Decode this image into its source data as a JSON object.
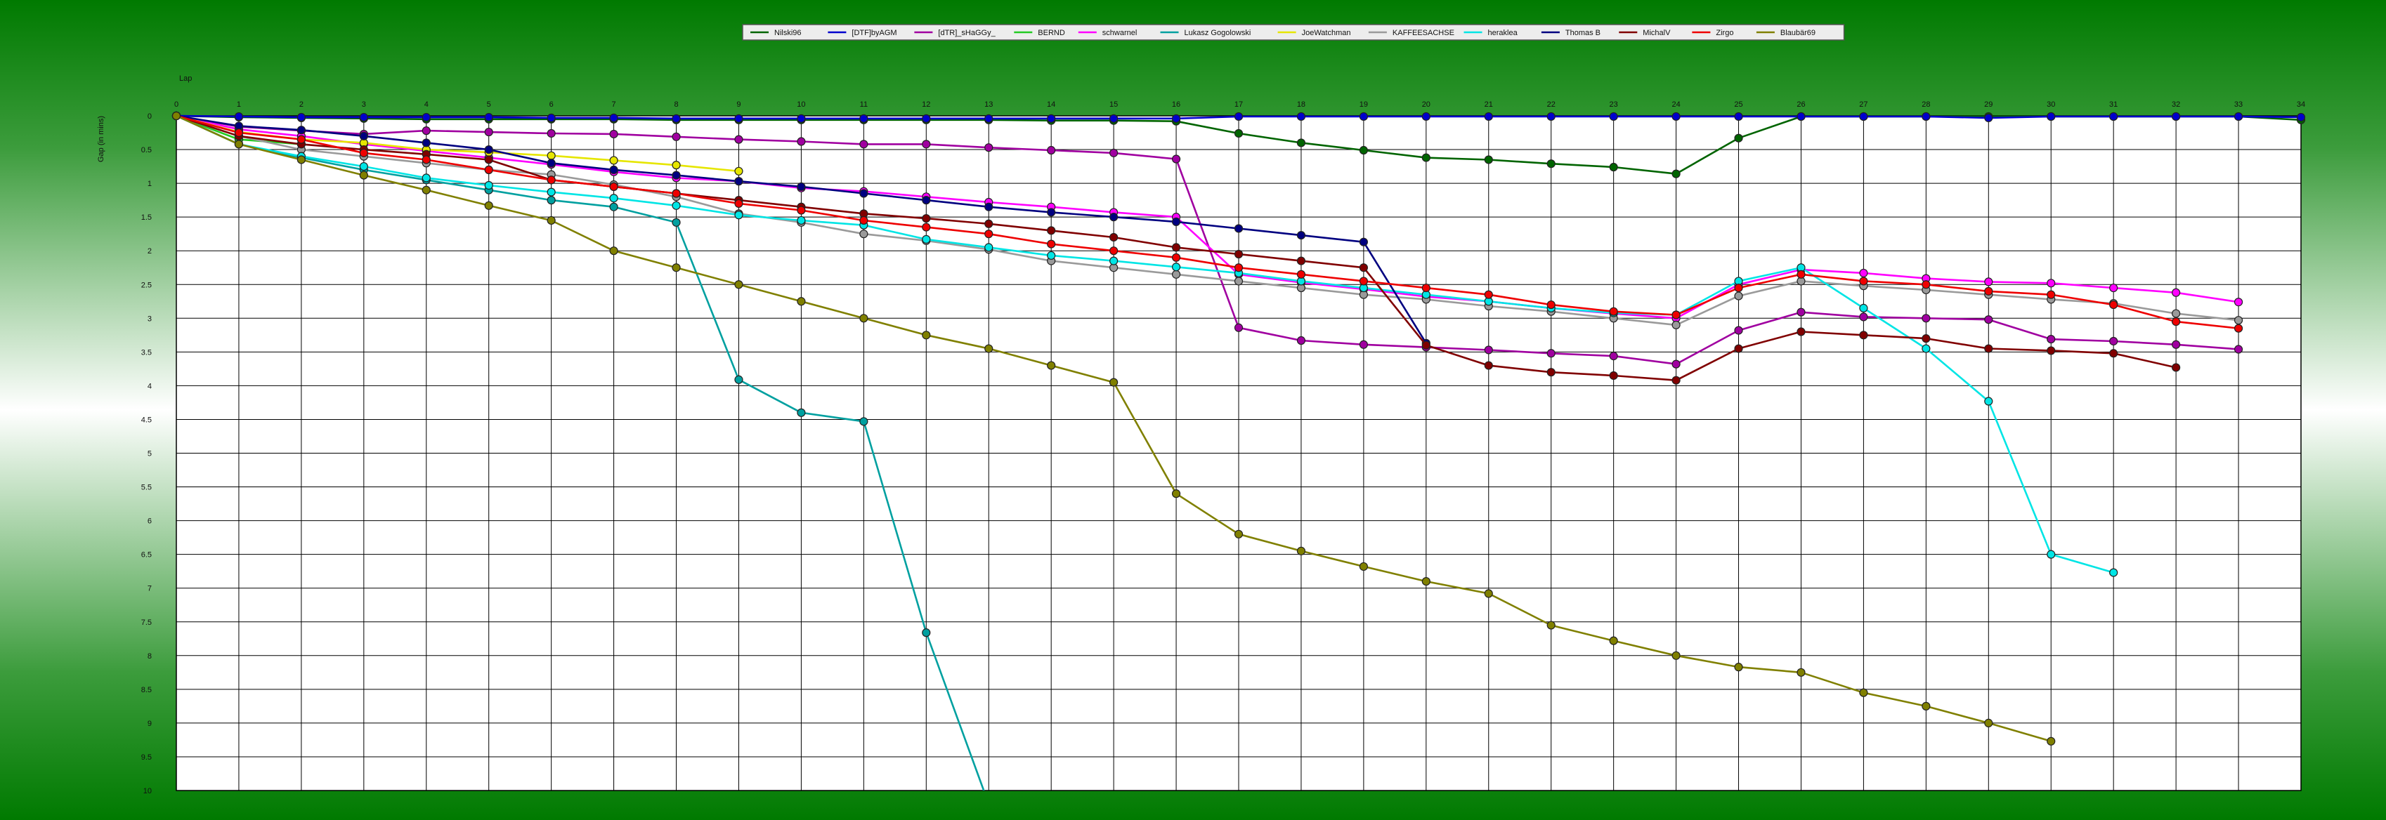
{
  "chart_data": {
    "type": "line",
    "xlabel": "Lap",
    "ylabel": "Gap (in mins)",
    "x_ticks": [
      "0",
      "1",
      "2",
      "3",
      "4",
      "5",
      "6",
      "7",
      "8",
      "9",
      "10",
      "11",
      "12",
      "13",
      "14",
      "15",
      "16",
      "17",
      "18",
      "19",
      "20",
      "21",
      "22",
      "23",
      "24",
      "25",
      "26",
      "27",
      "28",
      "29",
      "30",
      "31",
      "32",
      "33",
      "34"
    ],
    "y_ticks": [
      "0",
      "0.5",
      "1",
      "1.5",
      "2",
      "2.5",
      "3",
      "3.5",
      "4",
      "4.5",
      "5",
      "5.5",
      "6",
      "6.5",
      "7",
      "7.5",
      "8",
      "8.5",
      "9",
      "9.5",
      "10"
    ],
    "xlim": [
      0,
      34
    ],
    "ylim": [
      0,
      10
    ],
    "y_inverted": true,
    "grid": true,
    "legend_position": "top-center",
    "series": [
      {
        "name": "Nilski96",
        "color": "#006400",
        "x": [
          0,
          1,
          2,
          3,
          4,
          5,
          6,
          7,
          8,
          9,
          10,
          11,
          12,
          13,
          14,
          15,
          16,
          17,
          18,
          19,
          20,
          21,
          22,
          23,
          24,
          25,
          26,
          27,
          28,
          29,
          30,
          31,
          32,
          33,
          34
        ],
        "values": [
          0,
          0.02,
          0.03,
          0.04,
          0.05,
          0.05,
          0.05,
          0.05,
          0.06,
          0.06,
          0.06,
          0.06,
          0.06,
          0.06,
          0.07,
          0.07,
          0.08,
          0.26,
          0.4,
          0.51,
          0.62,
          0.65,
          0.71,
          0.76,
          0.86,
          0.33,
          0.01,
          0.01,
          0.01,
          0.01,
          0.01,
          0.01,
          0.01,
          0.01,
          0.06
        ]
      },
      {
        "name": "[DTF]byAGM",
        "color": "#0000cd",
        "x": [
          0,
          1,
          2,
          3,
          4,
          5,
          6,
          7,
          8,
          9,
          10,
          11,
          12,
          13,
          14,
          15,
          16,
          17,
          18,
          19,
          20,
          21,
          22,
          23,
          24,
          25,
          26,
          27,
          28,
          29,
          30,
          31,
          32,
          33,
          34
        ],
        "values": [
          0,
          0.01,
          0.02,
          0.02,
          0.02,
          0.02,
          0.03,
          0.03,
          0.04,
          0.04,
          0.04,
          0.04,
          0.04,
          0.04,
          0.04,
          0.04,
          0.04,
          0.01,
          0.01,
          0.01,
          0.01,
          0.01,
          0.01,
          0.01,
          0.01,
          0.01,
          0.01,
          0.01,
          0.01,
          0.03,
          0.01,
          0.01,
          0.01,
          0.01,
          0.02
        ]
      },
      {
        "name": "[dTR]_sHaGGy_",
        "color": "#a000a0",
        "x": [
          0,
          1,
          2,
          3,
          4,
          5,
          6,
          7,
          8,
          9,
          10,
          11,
          12,
          13,
          14,
          15,
          16,
          17,
          18,
          19,
          20,
          21,
          22,
          23,
          24,
          25,
          26,
          27,
          28,
          29,
          30,
          31,
          32,
          33
        ],
        "values": [
          0,
          0.16,
          0.22,
          0.27,
          0.22,
          0.24,
          0.26,
          0.27,
          0.31,
          0.35,
          0.38,
          0.42,
          0.42,
          0.47,
          0.51,
          0.55,
          0.64,
          3.14,
          3.33,
          3.39,
          3.43,
          3.47,
          3.52,
          3.56,
          3.68,
          3.18,
          2.91,
          2.98,
          3.0,
          3.02,
          3.31,
          3.34,
          3.39,
          3.46
        ]
      },
      {
        "name": "BERND",
        "color": "#22cc22",
        "x": [
          0,
          1,
          2
        ],
        "values": [
          0,
          0.35,
          0.42
        ]
      },
      {
        "name": "schwarnel",
        "color": "#ff00ff",
        "x": [
          0,
          1,
          2,
          3,
          4,
          5,
          6,
          7,
          8,
          9,
          10,
          11,
          12,
          13,
          14,
          15,
          16,
          17,
          18,
          19,
          20,
          21,
          22,
          23,
          24,
          25,
          26,
          27,
          28,
          29,
          30,
          31,
          32,
          33
        ],
        "values": [
          0,
          0.2,
          0.3,
          0.42,
          0.52,
          0.62,
          0.72,
          0.83,
          0.92,
          0.97,
          1.07,
          1.12,
          1.2,
          1.28,
          1.35,
          1.43,
          1.5,
          2.35,
          2.47,
          2.57,
          2.68,
          2.75,
          2.85,
          2.93,
          3.0,
          2.5,
          2.28,
          2.33,
          2.41,
          2.46,
          2.48,
          2.55,
          2.62,
          2.76
        ]
      },
      {
        "name": "Lukasz Gogolowski",
        "color": "#00a0a0",
        "x": [
          0,
          1,
          2,
          3,
          4,
          5,
          6,
          7,
          8,
          9,
          10,
          11,
          12,
          13
        ],
        "values": [
          0,
          0.42,
          0.62,
          0.8,
          0.95,
          1.1,
          1.25,
          1.35,
          1.58,
          3.91,
          4.4,
          4.53,
          7.66,
          10.2
        ]
      },
      {
        "name": "JoeWatchman",
        "color": "#e6e600",
        "x": [
          0,
          1,
          2,
          3,
          4,
          5,
          6,
          7,
          8,
          9
        ],
        "values": [
          0,
          0.24,
          0.35,
          0.4,
          0.5,
          0.54,
          0.59,
          0.66,
          0.73,
          0.82
        ]
      },
      {
        "name": "KAFFEESACHSE",
        "color": "#9a9a9a",
        "x": [
          0,
          1,
          2,
          3,
          4,
          5,
          6,
          7,
          8,
          9,
          10,
          11,
          12,
          13,
          14,
          15,
          16,
          17,
          18,
          19,
          20,
          21,
          22,
          23,
          24,
          25,
          26,
          27,
          28,
          29,
          30,
          31,
          32,
          33
        ],
        "values": [
          0,
          0.3,
          0.5,
          0.6,
          0.7,
          0.8,
          0.87,
          1.02,
          1.2,
          1.45,
          1.58,
          1.75,
          1.85,
          1.98,
          2.15,
          2.25,
          2.35,
          2.45,
          2.55,
          2.65,
          2.72,
          2.82,
          2.9,
          3.0,
          3.1,
          2.67,
          2.45,
          2.52,
          2.58,
          2.65,
          2.72,
          2.78,
          2.93,
          3.03
        ]
      },
      {
        "name": "heraklea",
        "color": "#00e5e5",
        "x": [
          0,
          1,
          2,
          3,
          4,
          5,
          6,
          7,
          8,
          9,
          10,
          11,
          12,
          13,
          14,
          15,
          16,
          17,
          18,
          19,
          20,
          21,
          22,
          23,
          24,
          25,
          26,
          27,
          28,
          29,
          30,
          31
        ],
        "values": [
          0,
          0.42,
          0.6,
          0.75,
          0.92,
          1.03,
          1.13,
          1.22,
          1.33,
          1.47,
          1.55,
          1.62,
          1.83,
          1.95,
          2.07,
          2.15,
          2.24,
          2.33,
          2.45,
          2.55,
          2.65,
          2.75,
          2.85,
          2.92,
          2.95,
          2.45,
          2.25,
          2.85,
          3.45,
          4.23,
          6.5,
          6.77
        ]
      },
      {
        "name": "Thomas B",
        "color": "#000080",
        "x": [
          0,
          1,
          2,
          3,
          4,
          5,
          6,
          7,
          8,
          9,
          10,
          11,
          12,
          13,
          14,
          15,
          16,
          17,
          18,
          19,
          20
        ],
        "values": [
          0,
          0.15,
          0.21,
          0.3,
          0.4,
          0.5,
          0.7,
          0.8,
          0.88,
          0.97,
          1.05,
          1.15,
          1.25,
          1.35,
          1.43,
          1.5,
          1.57,
          1.67,
          1.77,
          1.87,
          3.37
        ]
      },
      {
        "name": "MichalV",
        "color": "#800000",
        "x": [
          0,
          1,
          2,
          3,
          4,
          5,
          6,
          7,
          8,
          9,
          10,
          11,
          12,
          13,
          14,
          15,
          16,
          17,
          18,
          19,
          20,
          21,
          22,
          23,
          24,
          25,
          26,
          27,
          28,
          29,
          30,
          31,
          32
        ],
        "values": [
          0,
          0.3,
          0.42,
          0.5,
          0.57,
          0.65,
          0.95,
          1.05,
          1.15,
          1.25,
          1.35,
          1.45,
          1.52,
          1.6,
          1.7,
          1.8,
          1.95,
          2.05,
          2.15,
          2.25,
          3.4,
          3.7,
          3.8,
          3.85,
          3.92,
          3.45,
          3.2,
          3.25,
          3.3,
          3.45,
          3.48,
          3.52,
          3.73
        ]
      },
      {
        "name": "Zirgo",
        "color": "#ee0000",
        "x": [
          0,
          1,
          2,
          3,
          4,
          5,
          6,
          7,
          8,
          9,
          10,
          11,
          12,
          13,
          14,
          15,
          16,
          17,
          18,
          19,
          20,
          21,
          22,
          23,
          24,
          25,
          26,
          27,
          28,
          29,
          30,
          31,
          32,
          33
        ],
        "values": [
          0,
          0.25,
          0.35,
          0.55,
          0.65,
          0.8,
          0.95,
          1.05,
          1.15,
          1.3,
          1.4,
          1.55,
          1.65,
          1.75,
          1.9,
          2.0,
          2.1,
          2.25,
          2.35,
          2.45,
          2.55,
          2.65,
          2.8,
          2.9,
          2.95,
          2.55,
          2.35,
          2.45,
          2.5,
          2.6,
          2.65,
          2.8,
          3.05,
          3.15
        ]
      },
      {
        "name": "Blaubär69",
        "color": "#808000",
        "x": [
          0,
          1,
          2,
          3,
          4,
          5,
          6,
          7,
          8,
          9,
          10,
          11,
          12,
          13,
          14,
          15,
          16,
          17,
          18,
          19,
          20,
          21,
          22,
          23,
          24,
          25,
          26,
          27,
          28,
          29,
          30
        ],
        "values": [
          0,
          0.42,
          0.65,
          0.88,
          1.1,
          1.33,
          1.55,
          2.0,
          2.25,
          2.5,
          2.75,
          3.0,
          3.25,
          3.45,
          3.7,
          3.95,
          5.6,
          6.2,
          6.45,
          6.68,
          6.9,
          7.08,
          7.55,
          7.78,
          8.0,
          8.17,
          8.25,
          8.55,
          8.75,
          9.0,
          9.27
        ]
      }
    ]
  }
}
